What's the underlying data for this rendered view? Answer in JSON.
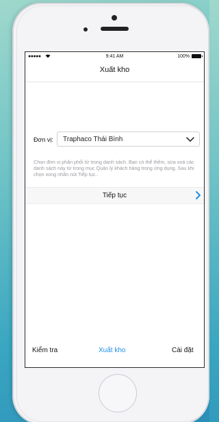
{
  "status_bar": {
    "signal": "●●●●●",
    "time": "9:41 AM",
    "battery": "100%"
  },
  "nav": {
    "title": "Xuất kho"
  },
  "form": {
    "unit_label": "Đơn vị:",
    "unit_value": "Traphaco Thái Bình",
    "help_text": "Chọn đơn vị phân phối từ trong danh sách. Bạn có thể thêm, sửa xoá các danh sách này từ trong mục Quản lý khách hàng trong ứng dụng. Sau khi chọn xong nhấn nút Tiếp tục.."
  },
  "actions": {
    "continue_label": "Tiếp tục"
  },
  "tabs": [
    {
      "label": "Kiểm tra",
      "active": false
    },
    {
      "label": "Xuất kho",
      "active": true
    },
    {
      "label": "Cài đặt",
      "active": false
    }
  ],
  "colors": {
    "accent": "#1f8fe8",
    "background_gradient_start": "#9fd8cc",
    "background_gradient_end": "#2b8fb9"
  },
  "icons": [
    "signal-dots-icon",
    "wifi-icon",
    "battery-icon",
    "chevron-down-icon",
    "chevron-right-icon"
  ]
}
